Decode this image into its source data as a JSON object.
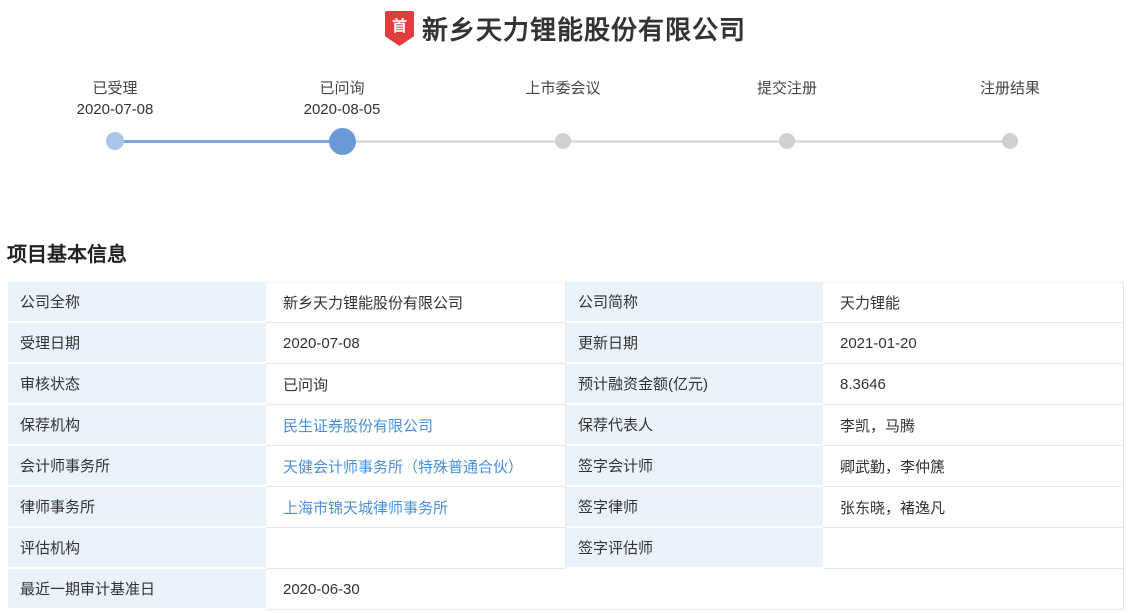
{
  "header": {
    "badge": "首",
    "title": "新乡天力锂能股份有限公司"
  },
  "timeline": {
    "steps": [
      {
        "label": "已受理",
        "date": "2020-07-08",
        "state": "done"
      },
      {
        "label": "已问询",
        "date": "2020-08-05",
        "state": "active"
      },
      {
        "label": "上市委会议",
        "date": "",
        "state": "pending"
      },
      {
        "label": "提交注册",
        "date": "",
        "state": "pending"
      },
      {
        "label": "注册结果",
        "date": "",
        "state": "pending"
      }
    ]
  },
  "section": {
    "title": "项目基本信息"
  },
  "table": {
    "rows": [
      {
        "c0": {
          "label": "公司全称",
          "value": "新乡天力锂能股份有限公司"
        },
        "c1": {
          "label": "公司简称",
          "value": "天力锂能"
        }
      },
      {
        "c0": {
          "label": "受理日期",
          "value": "2020-07-08"
        },
        "c1": {
          "label": "更新日期",
          "value": "2021-01-20"
        }
      },
      {
        "c0": {
          "label": "审核状态",
          "value": "已问询"
        },
        "c1": {
          "label": "预计融资金额(亿元)",
          "value": "8.3646"
        }
      },
      {
        "c0": {
          "label": "保荐机构",
          "value": "民生证券股份有限公司"
        },
        "c1": {
          "label": "保荐代表人",
          "value": "李凯，马腾"
        }
      },
      {
        "c0": {
          "label": "会计师事务所",
          "value": "天健会计师事务所（特殊普通合伙）"
        },
        "c1": {
          "label": "签字会计师",
          "value": "卿武勤，李仲篪"
        }
      },
      {
        "c0": {
          "label": "律师事务所",
          "value": "上海市锦天城律师事务所"
        },
        "c1": {
          "label": "签字律师",
          "value": "张东晓，褚逸凡"
        }
      },
      {
        "c0": {
          "label": "评估机构",
          "value": ""
        },
        "c1": {
          "label": "签字评估师",
          "value": ""
        }
      },
      {
        "c0": {
          "label": "最近一期审计基准日",
          "value": "2020-06-30"
        }
      }
    ]
  },
  "colors": {
    "badge_red": "#e23d3e",
    "link_blue": "#4a90d6",
    "dot_done": "#a9c6e8",
    "dot_active": "#6b9bd7",
    "dot_pending": "#d0d0d0",
    "label_cell_bg": "#eaf2fa"
  }
}
